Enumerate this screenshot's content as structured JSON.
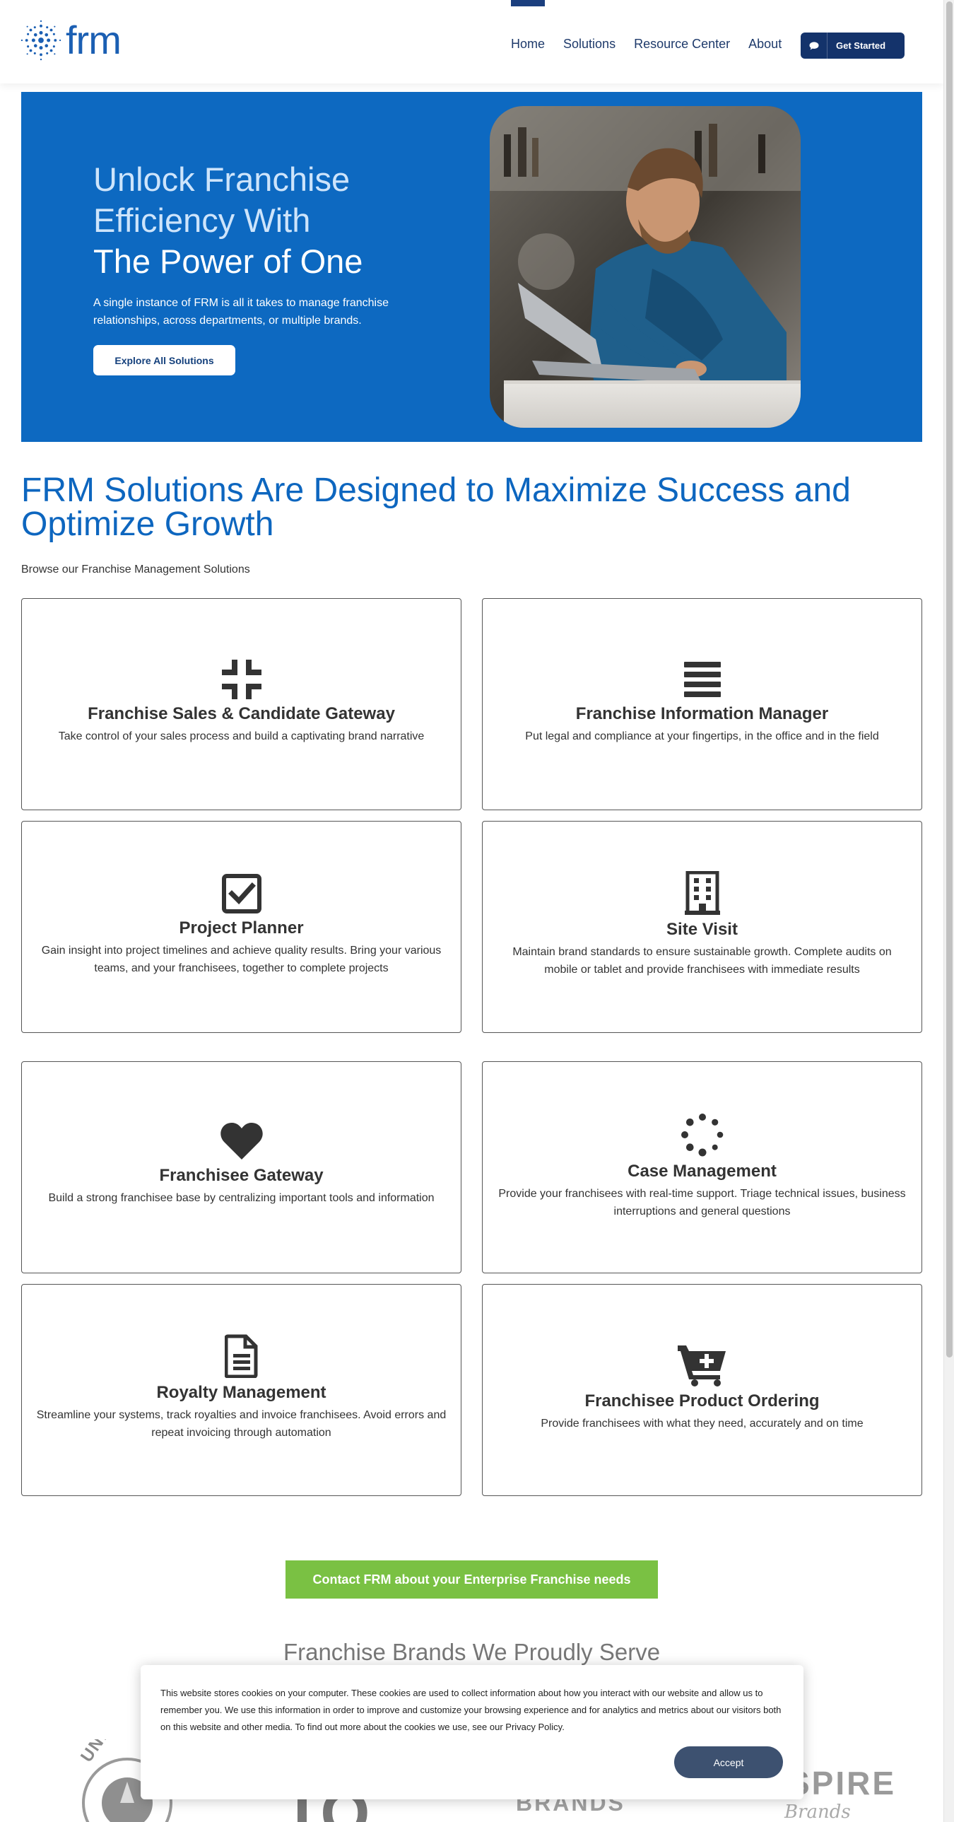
{
  "header": {
    "logo_text": "frm",
    "nav": [
      "Home",
      "Solutions",
      "Resource Center",
      "About"
    ],
    "cta_label": "Get Started"
  },
  "hero": {
    "title_line1": "Unlock Franchise",
    "title_line2": "Efficiency With",
    "title_line3": "The Power of One",
    "text": "A single instance of FRM is all it takes to manage franchise relationships, across departments, or multiple brands.",
    "button_label": "Explore All Solutions"
  },
  "solutions": {
    "title": "FRM Solutions Are Designed to Maximize Success and Optimize Growth",
    "subtitle": "Browse our Franchise Management Solutions",
    "cards": [
      {
        "icon": "compress-icon",
        "title": "Franchise Sales & Candidate Gateway",
        "desc": "Take control of your sales process and build a captivating brand narrative"
      },
      {
        "icon": "bars-icon",
        "title": "Franchise Information Manager",
        "desc": "Put legal and compliance at your fingertips, in the office and in the field"
      },
      {
        "icon": "checkbox-icon",
        "title": "Project Planner",
        "desc": "Gain insight into project timelines and achieve quality results. Bring your various teams, and your franchisees, together to complete projects"
      },
      {
        "icon": "building-icon",
        "title": "Site Visit",
        "desc": "Maintain brand standards to ensure sustainable growth. Complete audits on mobile or tablet and provide franchisees with immediate results"
      },
      {
        "icon": "heart-icon",
        "title": "Franchisee Gateway",
        "desc": "Build a strong franchisee base by centralizing important tools and information"
      },
      {
        "icon": "spinner-icon",
        "title": "Case Management",
        "desc": "Provide your franchisees with real-time support. Triage technical issues, business interruptions and general questions"
      },
      {
        "icon": "document-icon",
        "title": "Royalty Management",
        "desc": "Streamline your systems, track royalties and invoice franchisees. Avoid errors and repeat invoicing through automation"
      },
      {
        "icon": "cart-plus-icon",
        "title": "Franchisee Product Ordering",
        "desc": "Provide franchisees with what they need, accurately and on time"
      }
    ]
  },
  "contact": {
    "button_label": "Contact FRM about your Enterprise Franchise needs"
  },
  "brands": {
    "title": "Franchise Brands We Proudly Serve",
    "logo_1": "UNLEASH",
    "logo_2": "TO",
    "logo_3": "BRANDS",
    "logo_4": "INSPIRE",
    "logo_4_sub": "Brands"
  },
  "cookie": {
    "text": "This website stores cookies on your computer. These cookies are used to collect information about how you interact with our website and allow us to remember you. We use this information in order to improve and customize your browsing experience and for analytics and metrics about our visitors both on this website and other media. To find out more about the cookies we use, see our Privacy Policy.",
    "accept_label": "Accept"
  },
  "colors": {
    "brand_blue": "#0d69c1",
    "navy": "#14336b",
    "green": "#7ac143"
  }
}
